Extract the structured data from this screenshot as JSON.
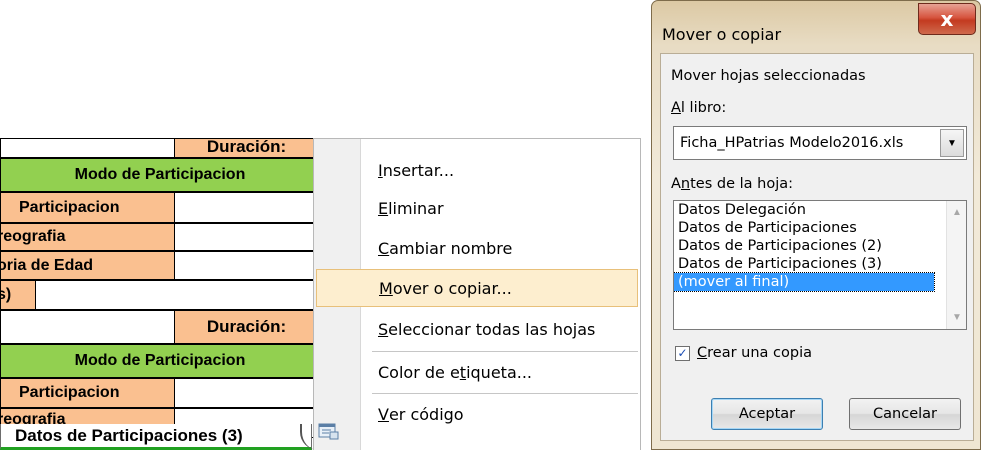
{
  "sheet": {
    "duracion_label": "Duración:",
    "modo_header": "Modo de Participacion",
    "row_participacion": "Participacion",
    "row_coreografia": "reografia",
    "row_categoria": "oria de Edad",
    "row_paren": "s)",
    "row_coreografia_cut": "reografia",
    "active_tab": "Datos de Participaciones (3)"
  },
  "context_menu": {
    "items": [
      {
        "pre": "",
        "u": "I",
        "post": "nsertar..."
      },
      {
        "pre": "",
        "u": "E",
        "post": "liminar"
      },
      {
        "pre": "",
        "u": "C",
        "post": "ambiar nombre"
      },
      {
        "pre": "",
        "u": "M",
        "post": "over o copiar..."
      },
      {
        "pre": "",
        "u": "S",
        "post": "eleccionar todas las hojas"
      },
      {
        "pre": "Color de e",
        "u": "t",
        "post": "iqueta..."
      },
      {
        "pre": "",
        "u": "V",
        "post": "er código"
      }
    ],
    "hovered": "Mover o copiar..."
  },
  "dialog": {
    "title": "Mover o copiar",
    "close_label": "x",
    "move_label": "Mover hojas seleccionadas",
    "book_label": {
      "u": "A",
      "post": "l libro:"
    },
    "book_value": "Ficha_HPatrias Modelo2016.xls",
    "before_label": {
      "pre": "A",
      "u": "n",
      "post": "tes de la hoja:"
    },
    "sheets": [
      "Datos Delegación",
      "Datos de Participaciones",
      "Datos de Participaciones (2)",
      "Datos de Participaciones (3)",
      "(mover al final)"
    ],
    "selected_sheet": "(mover al final)",
    "copy_checkbox": {
      "u": "C",
      "post": "rear una copia",
      "checked": true
    },
    "ok_label": "Aceptar",
    "cancel_label": "Cancelar"
  }
}
